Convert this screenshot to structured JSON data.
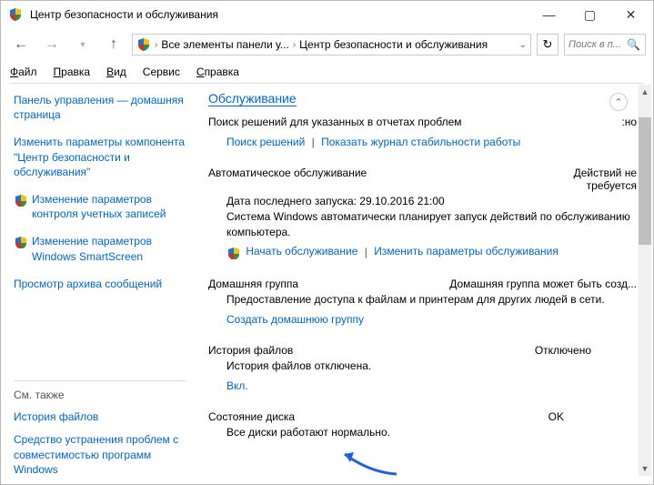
{
  "window": {
    "title": "Центр безопасности и обслуживания"
  },
  "breadcrumb": {
    "part1": "Все элементы панели у...",
    "part2": "Центр безопасности и обслуживания"
  },
  "search": {
    "placeholder": "Поиск в п..."
  },
  "menu": {
    "file": "айл",
    "edit": "равка",
    "view": "ид",
    "tools": "Сервис",
    "help": "правка"
  },
  "sidebar": {
    "home": "Панель управления — домашняя страница",
    "change_center": "Изменить параметры компонента \"Центр безопасности и обслуживания\"",
    "uac": "Изменение параметров контроля учетных записей",
    "smartscreen": "Изменение параметров Windows SmartScreen",
    "archive": "Просмотр архива сообщений",
    "see_also": "См. также",
    "history": "История файлов",
    "troubleshoot": "Средство устранения проблем с совместимостью программ Windows"
  },
  "main": {
    "heading": "Обслуживание",
    "search_problems": {
      "label": "Поиск решений для указанных в отчетах проблем",
      "status": ":но",
      "link1": "Поиск решений",
      "link2": "Показать журнал стабильности работы"
    },
    "auto_maint": {
      "label": "Автоматическое обслуживание",
      "status": "Действий не требуется",
      "last_run": "Дата последнего запуска: 29.10.2016 21:00",
      "desc": "Система Windows автоматически планирует запуск действий по обслуживанию компьютера.",
      "link1": "Начать обслуживание",
      "link2": "Изменить параметры обслуживания"
    },
    "homegroup": {
      "label": "Домашняя группа",
      "status": "Домашняя группа может быть созд...",
      "desc": "Предоставление доступа к файлам и принтерам для других людей в сети.",
      "link": "Создать домашнюю группу"
    },
    "file_history": {
      "label": "История файлов",
      "status": "Отключено",
      "desc": "История файлов отключена.",
      "link": "Вкл."
    },
    "disk": {
      "label": "Состояние диска",
      "status": "OK",
      "desc": "Все диски работают нормально."
    }
  }
}
